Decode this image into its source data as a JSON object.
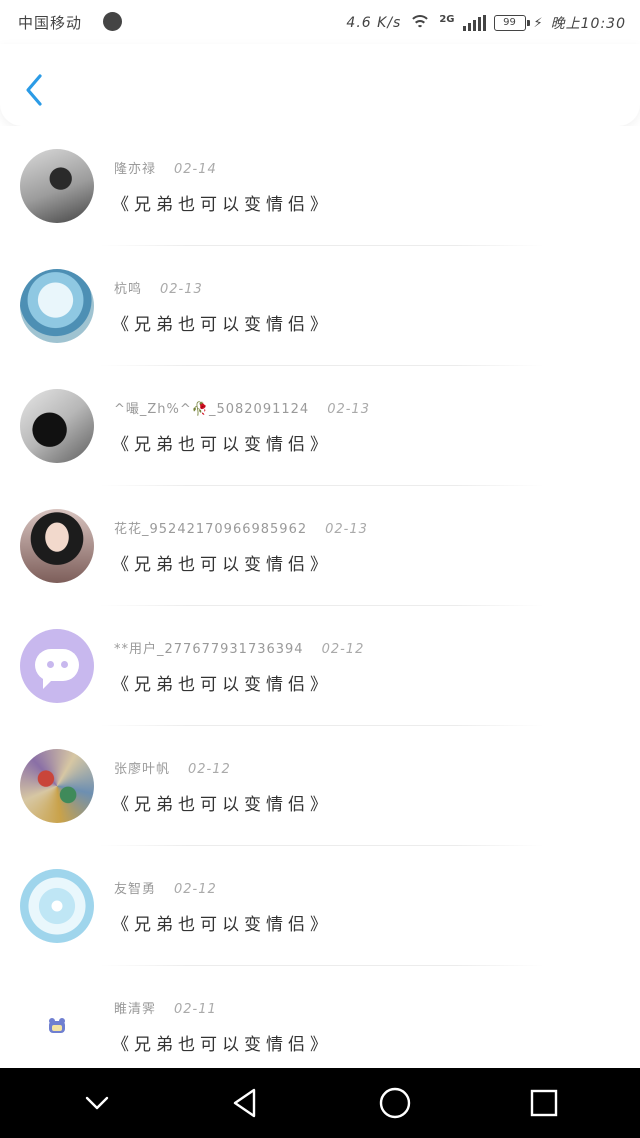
{
  "status_bar": {
    "carrier": "中国移动",
    "speed": "4.6 K/s",
    "network": "2G",
    "battery": "99",
    "time": "晚上10:30"
  },
  "header": {
    "back_icon": "chevron-left-icon",
    "accent_color": "#2b9be6"
  },
  "items": [
    {
      "name": "隆亦禄",
      "date": "02-14",
      "text": "《兄弟也可以变情侣》"
    },
    {
      "name": "杭鸣",
      "date": "02-13",
      "text": "《兄弟也可以变情侣》"
    },
    {
      "name": "^嘬_Zh%^🥀_5082091124",
      "date": "02-13",
      "text": "《兄弟也可以变情侣》"
    },
    {
      "name": "花花_95242170966985962",
      "date": "02-13",
      "text": "《兄弟也可以变情侣》"
    },
    {
      "name": "**用户_277677931736394",
      "date": "02-12",
      "text": "《兄弟也可以变情侣》"
    },
    {
      "name": "张廖叶帆",
      "date": "02-12",
      "text": "《兄弟也可以变情侣》"
    },
    {
      "name": "友智勇",
      "date": "02-12",
      "text": "《兄弟也可以变情侣》"
    },
    {
      "name": "睢清霁",
      "date": "02-11",
      "text": "《兄弟也可以变情侣》"
    }
  ],
  "nav_bar": {
    "icons": [
      "chevron-down-icon",
      "back-triangle-icon",
      "home-circle-icon",
      "recents-square-icon"
    ]
  }
}
